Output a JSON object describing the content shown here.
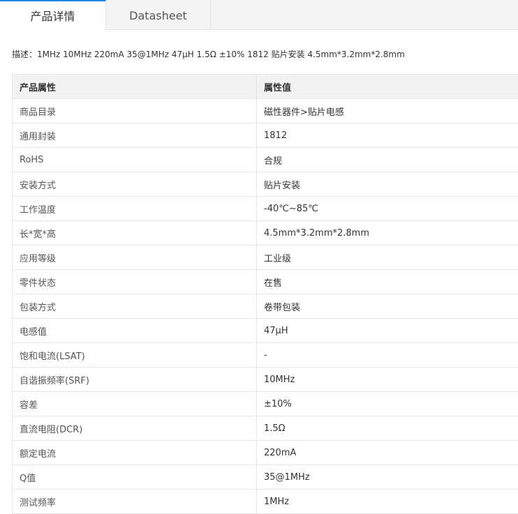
{
  "tabs": [
    {
      "label": "产品详情",
      "active": true
    },
    {
      "label": "Datasheet",
      "active": false
    }
  ],
  "description": "描述：1MHz 10MHz 220mA 35@1MHz 47μH 1.5Ω ±10% 1812 贴片安装 4.5mm*3.2mm*2.8mm",
  "table": {
    "headers": [
      "产品属性",
      "属性值"
    ],
    "rows": [
      [
        "商品目录",
        "磁性器件>贴片电感"
      ],
      [
        "通用封装",
        "1812"
      ],
      [
        "RoHS",
        "合规"
      ],
      [
        "安装方式",
        "贴片安装"
      ],
      [
        "工作温度",
        "-40℃~85℃"
      ],
      [
        "长*宽*高",
        "4.5mm*3.2mm*2.8mm"
      ],
      [
        "应用等级",
        "工业级"
      ],
      [
        "零件状态",
        "在售"
      ],
      [
        "包装方式",
        "卷带包装"
      ],
      [
        "电感值",
        "47μH"
      ],
      [
        "饱和电流(LSAT)",
        "-"
      ],
      [
        "自谐振频率(SRF)",
        "10MHz"
      ],
      [
        "容差",
        "±10%"
      ],
      [
        "直流电阻(DCR)",
        "1.5Ω"
      ],
      [
        "额定电流",
        "220mA"
      ],
      [
        "Q值",
        "35@1MHz"
      ],
      [
        "测试频率",
        "1MHz"
      ]
    ]
  },
  "colors": {
    "accent": "#1e88e5",
    "header_bg": "#f2f2f2",
    "tabbar_bg": "#f5f5f5",
    "border": "#e6e6e6"
  }
}
